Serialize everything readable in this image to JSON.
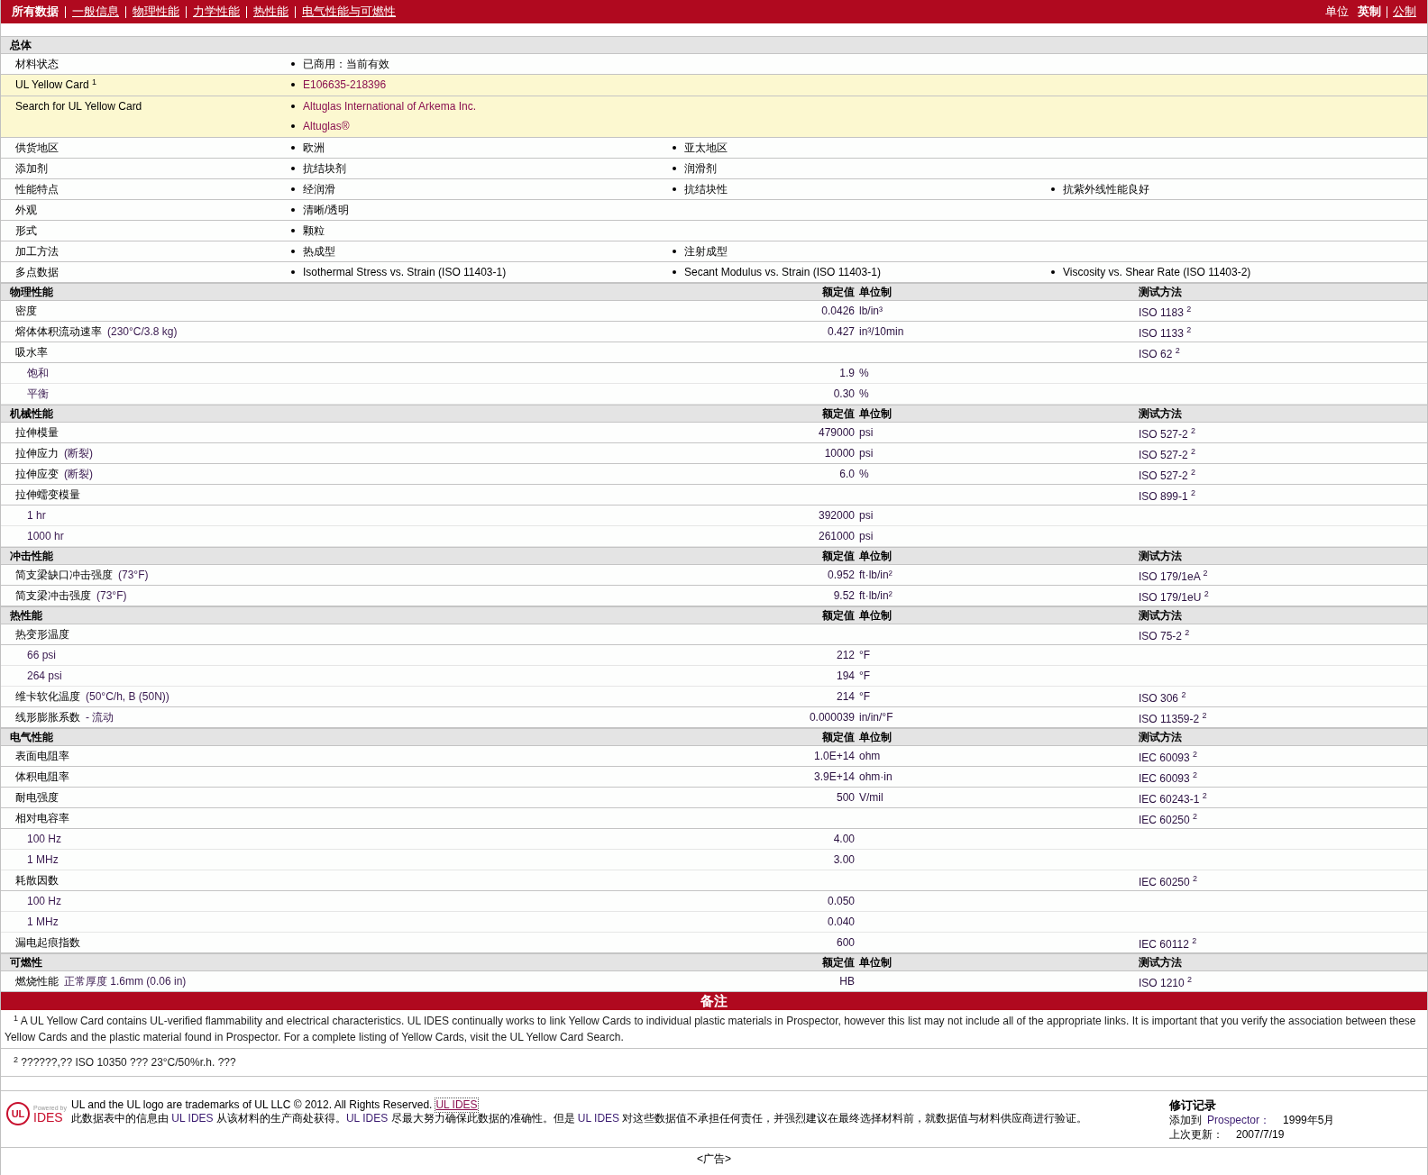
{
  "nav": {
    "items": [
      {
        "label": "所有数据",
        "selected": true
      },
      {
        "label": "一般信息",
        "selected": false
      },
      {
        "label": "物理性能",
        "selected": false
      },
      {
        "label": "力学性能",
        "selected": false
      },
      {
        "label": "热性能",
        "selected": false
      },
      {
        "label": "电气性能与可燃性",
        "selected": false
      }
    ],
    "units": {
      "label": "单位",
      "options": [
        {
          "label": "英制",
          "selected": true
        },
        {
          "label": "公制",
          "selected": false
        }
      ]
    }
  },
  "general": {
    "title": "总体",
    "rows": [
      {
        "label": "材料状态",
        "highlighted": false,
        "kind": "columns",
        "values": [
          "已商用：当前有效"
        ]
      },
      {
        "label": "UL Yellow Card $^{1}$",
        "highlighted": true,
        "kind": "links",
        "values": [
          "E106635-218396"
        ]
      },
      {
        "label": "Search for UL Yellow Card",
        "highlighted": true,
        "kind": "links",
        "values": [
          "Altuglas International of Arkema Inc.",
          "Altuglas®"
        ]
      },
      {
        "label": "供货地区",
        "highlighted": false,
        "kind": "columns",
        "values": [
          "欧洲",
          "亚太地区"
        ]
      },
      {
        "label": "添加剂",
        "highlighted": false,
        "kind": "columns",
        "values": [
          "抗结块剂",
          "润滑剂"
        ]
      },
      {
        "label": "性能特点",
        "highlighted": false,
        "kind": "columns",
        "values": [
          "经润滑",
          "抗结块性",
          "抗紫外线性能良好"
        ]
      },
      {
        "label": "外观",
        "highlighted": false,
        "kind": "columns",
        "values": [
          "清晰/透明"
        ]
      },
      {
        "label": "形式",
        "highlighted": false,
        "kind": "columns",
        "values": [
          "颗粒"
        ]
      },
      {
        "label": "加工方法",
        "highlighted": false,
        "kind": "columns",
        "values": [
          "热成型",
          "注射成型"
        ]
      },
      {
        "label": "多点数据",
        "highlighted": false,
        "kind": "columns",
        "values": [
          "Isothermal Stress vs. Strain (ISO 11403-1)",
          "Secant Modulus vs. Strain (ISO 11403-1)",
          "Viscosity vs. Shear Rate (ISO 11403-2)"
        ]
      }
    ]
  },
  "sections": [
    {
      "title": "物理性能",
      "columns": [
        "额定值",
        "单位制",
        "测试方法"
      ],
      "rows": [
        {
          "label": "密度",
          "value": "0.0426",
          "unit": "lb/in³",
          "method": "ISO 1183 $^{2}$"
        },
        {
          "label": "熔体体积流动速率",
          "condition": "(230°C/3.8 kg)",
          "value": "0.427",
          "unit": "in³/10min",
          "method": "ISO 1133 $^{2}$"
        },
        {
          "label": "吸水率",
          "method": "ISO 62 $^{2}$",
          "children": [
            {
              "label": "饱和",
              "value": "1.9",
              "unit": "%"
            },
            {
              "label": "平衡",
              "value": "0.30",
              "unit": "%"
            }
          ]
        }
      ]
    },
    {
      "title": "机械性能",
      "columns": [
        "额定值",
        "单位制",
        "测试方法"
      ],
      "rows": [
        {
          "label": "拉伸模量",
          "value": "479000",
          "unit": "psi",
          "method": "ISO 527-2 $^{2}$"
        },
        {
          "label": "拉伸应力",
          "condition": "(断裂)",
          "value": "10000",
          "unit": "psi",
          "method": "ISO 527-2 $^{2}$"
        },
        {
          "label": "拉伸应变",
          "condition": "(断裂)",
          "value": "6.0",
          "unit": "%",
          "method": "ISO 527-2 $^{2}$"
        },
        {
          "label": "拉伸蠕变模量",
          "method": "ISO 899-1 $^{2}$",
          "children": [
            {
              "label": "1 hr",
              "value": "392000",
              "unit": "psi"
            },
            {
              "label": "1000 hr",
              "value": "261000",
              "unit": "psi"
            }
          ]
        }
      ]
    },
    {
      "title": "冲击性能",
      "columns": [
        "额定值",
        "单位制",
        "测试方法"
      ],
      "rows": [
        {
          "label": "简支梁缺口冲击强度",
          "condition": "(73°F)",
          "value": "0.952",
          "unit": "ft·lb/in²",
          "method": "ISO 179/1eA $^{2}$"
        },
        {
          "label": "简支梁冲击强度",
          "condition": "(73°F)",
          "value": "9.52",
          "unit": "ft·lb/in²",
          "method": "ISO 179/1eU $^{2}$"
        }
      ]
    },
    {
      "title": "热性能",
      "columns": [
        "额定值",
        "单位制",
        "测试方法"
      ],
      "rows": [
        {
          "label": "热变形温度",
          "method": "ISO 75-2 $^{2}$",
          "children": [
            {
              "label": "66 psi",
              "value": "212",
              "unit": "°F"
            },
            {
              "label": "264 psi",
              "value": "194",
              "unit": "°F"
            }
          ]
        },
        {
          "label": "维卡软化温度",
          "condition": "(50°C/h, B (50N))",
          "value": "214",
          "unit": "°F",
          "method": "ISO 306 $^{2}$"
        },
        {
          "label": "线形膨胀系数",
          "condition": "- 流动",
          "value": "0.000039",
          "unit": "in/in/°F",
          "method": "ISO 11359-2 $^{2}$"
        }
      ]
    },
    {
      "title": "电气性能",
      "columns": [
        "额定值",
        "单位制",
        "测试方法"
      ],
      "rows": [
        {
          "label": "表面电阻率",
          "value": "1.0E+14",
          "unit": "ohm",
          "method": "IEC 60093 $^{2}$"
        },
        {
          "label": "体积电阻率",
          "value": "3.9E+14",
          "unit": "ohm·in",
          "method": "IEC 60093 $^{2}$"
        },
        {
          "label": "耐电强度",
          "value": "500",
          "unit": "V/mil",
          "method": "IEC 60243-1 $^{2}$"
        },
        {
          "label": "相对电容率",
          "method": "IEC 60250 $^{2}$",
          "children": [
            {
              "label": "100 Hz",
              "value": "4.00"
            },
            {
              "label": "1 MHz",
              "value": "3.00"
            }
          ]
        },
        {
          "label": "耗散因数",
          "method": "IEC 60250 $^{2}$",
          "children": [
            {
              "label": "100 Hz",
              "value": "0.050"
            },
            {
              "label": "1 MHz",
              "value": "0.040"
            }
          ]
        },
        {
          "label": "漏电起痕指数",
          "value": "600",
          "method": "IEC 60112 $^{2}$"
        }
      ]
    },
    {
      "title": "可燃性",
      "columns": [
        "额定值",
        "单位制",
        "测试方法"
      ],
      "rows": [
        {
          "label": "燃烧性能",
          "condition": "正常厚度 1.6mm (0.06 in)",
          "value": "HB",
          "method": "ISO 1210 $^{2}$"
        }
      ]
    }
  ],
  "notes": {
    "title": "备注",
    "items": [
      "$^{1}$ A UL Yellow Card contains UL-verified flammability and electrical characteristics. UL IDES continually works to link Yellow Cards to individual plastic materials in Prospector, however this list may not include all of the appropriate links. It is important that you verify the association between these Yellow Cards and the plastic material found in Prospector. For a complete listing of Yellow Cards, visit the UL Yellow Card Search.",
      "$^{2}$ ??????,?? ISO 10350 ??? 23°C/50%r.h. ???"
    ]
  },
  "footer": {
    "logo": {
      "mark": "UL",
      "tagline": "Powered by",
      "name": "IDES"
    },
    "trademark": "UL and the UL logo are trademarks of UL LLC © 2012. All Rights Reserved.",
    "trademark_link": "UL IDES",
    "disclaimer": [
      {
        "kind": "plain",
        "text": "此数据表中的信息由 "
      },
      {
        "kind": "brand",
        "text": "UL IDES"
      },
      {
        "kind": "plain",
        "text": " 从该材料的生产商处获得。"
      },
      {
        "kind": "brand",
        "text": "UL IDES"
      },
      {
        "kind": "plain",
        "text": " 尽最大努力确保此数据的准确性。但是 "
      },
      {
        "kind": "brand",
        "text": "UL IDES"
      },
      {
        "kind": "plain",
        "text": " 对这些数据值不承担任何责任，并强烈建议在最终选择材料前，就数据值与材料供应商进行验证。"
      }
    ],
    "revision": {
      "title": "修订记录",
      "items": [
        {
          "label": "添加到 ",
          "source": "Prospector：",
          "value": "1999年5月"
        },
        {
          "label": "上次更新：",
          "value": "2007/7/19"
        }
      ]
    },
    "ad": "<广告>"
  }
}
